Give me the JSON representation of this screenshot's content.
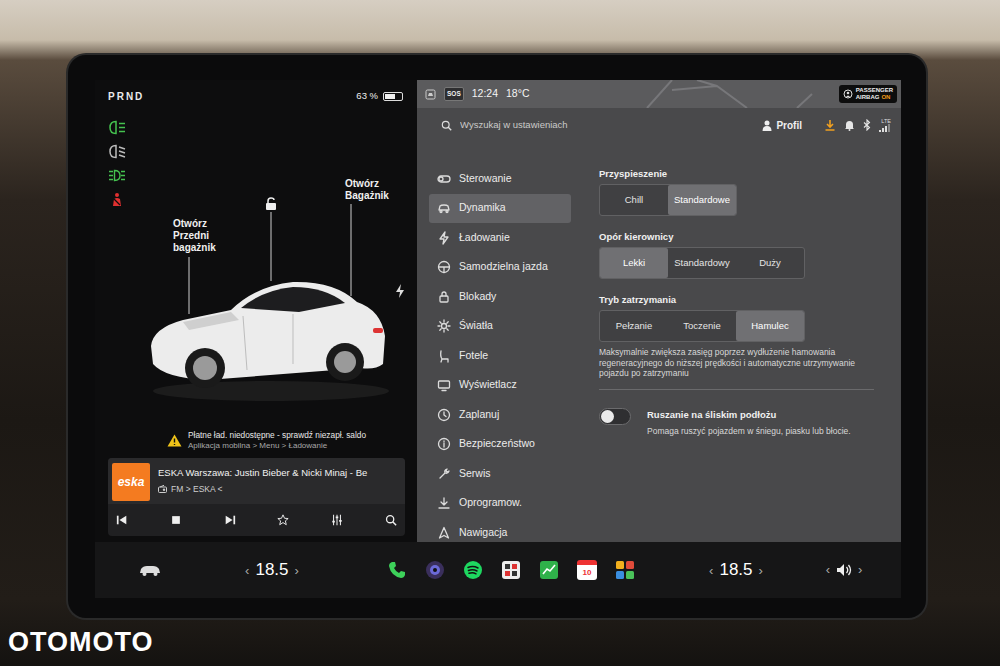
{
  "status": {
    "gear": "PRND",
    "battery": {
      "reading": "63 %",
      "level": 0.63
    }
  },
  "car": {
    "front_trunk": "Otwórz Przedni bagażnik",
    "rear_trunk": "Otwórz Bagażnik"
  },
  "alert": {
    "title": "Płatne ład. niedostępne - sprawdź niezapł. saldo",
    "subtitle": "Aplikacja mobilna > Menu > Ładowanie"
  },
  "media": {
    "logo": "eska",
    "title": "ESKA Warszawa: Justin Bieber & Nicki Minaj - Be",
    "source": "FM > ESKA <"
  },
  "topbar": {
    "sos": "SOS",
    "time": "12:24",
    "temperature": "18°C",
    "airbag": {
      "line1": "PASSENGER",
      "line2": "AIRBAG",
      "state": "ON"
    }
  },
  "search": {
    "placeholder": "Wyszukaj w ustawieniach"
  },
  "profile": {
    "label": "Profil"
  },
  "connectivity": {
    "network": "LTE"
  },
  "menu": [
    {
      "label": "Sterowanie",
      "selected": false
    },
    {
      "label": "Dynamika",
      "selected": true
    },
    {
      "label": "Ładowanie",
      "selected": false
    },
    {
      "label": "Samodzielna jazda",
      "selected": false
    },
    {
      "label": "Blokady",
      "selected": false
    },
    {
      "label": "Światła",
      "selected": false
    },
    {
      "label": "Fotele",
      "selected": false
    },
    {
      "label": "Wyświetlacz",
      "selected": false
    },
    {
      "label": "Zaplanuj",
      "selected": false
    },
    {
      "label": "Bezpieczeństwo",
      "selected": false
    },
    {
      "label": "Serwis",
      "selected": false
    },
    {
      "label": "Oprogramow.",
      "selected": false
    },
    {
      "label": "Nawigacja",
      "selected": false
    }
  ],
  "settings": {
    "groups": [
      {
        "title": "Przyspieszenie",
        "options": [
          {
            "label": "Chill",
            "selected": false
          },
          {
            "label": "Standardowe",
            "selected": true
          }
        ]
      },
      {
        "title": "Opór kierownicy",
        "options": [
          {
            "label": "Lekki",
            "selected": true
          },
          {
            "label": "Standardowy",
            "selected": false
          },
          {
            "label": "Duży",
            "selected": false
          }
        ]
      },
      {
        "title": "Tryb zatrzymania",
        "options": [
          {
            "label": "Pełzanie",
            "selected": false
          },
          {
            "label": "Toczenie",
            "selected": false
          },
          {
            "label": "Hamulec",
            "selected": true
          }
        ],
        "description": "Maksymalnie zwiększa zasięg poprzez wydłużenie hamowania regeneracyjnego do niższej prędkości i automatyczne utrzymywanie pojazdu po zatrzymaniu"
      }
    ],
    "toggle": {
      "label": "Ruszanie na śliskim podłożu",
      "description": "Pomaga ruszyć pojazdem w śniegu, piasku lub błocie.",
      "on": false
    }
  },
  "dock": {
    "left_climate": {
      "prev": "‹",
      "value": "18.5",
      "next": "›"
    },
    "calendar": "10",
    "right_climate": {
      "prev": "‹",
      "value": "18.5",
      "next": "›"
    },
    "volume": {
      "prev": "‹",
      "next": "›"
    }
  },
  "watermark": "OTOMOTO"
}
